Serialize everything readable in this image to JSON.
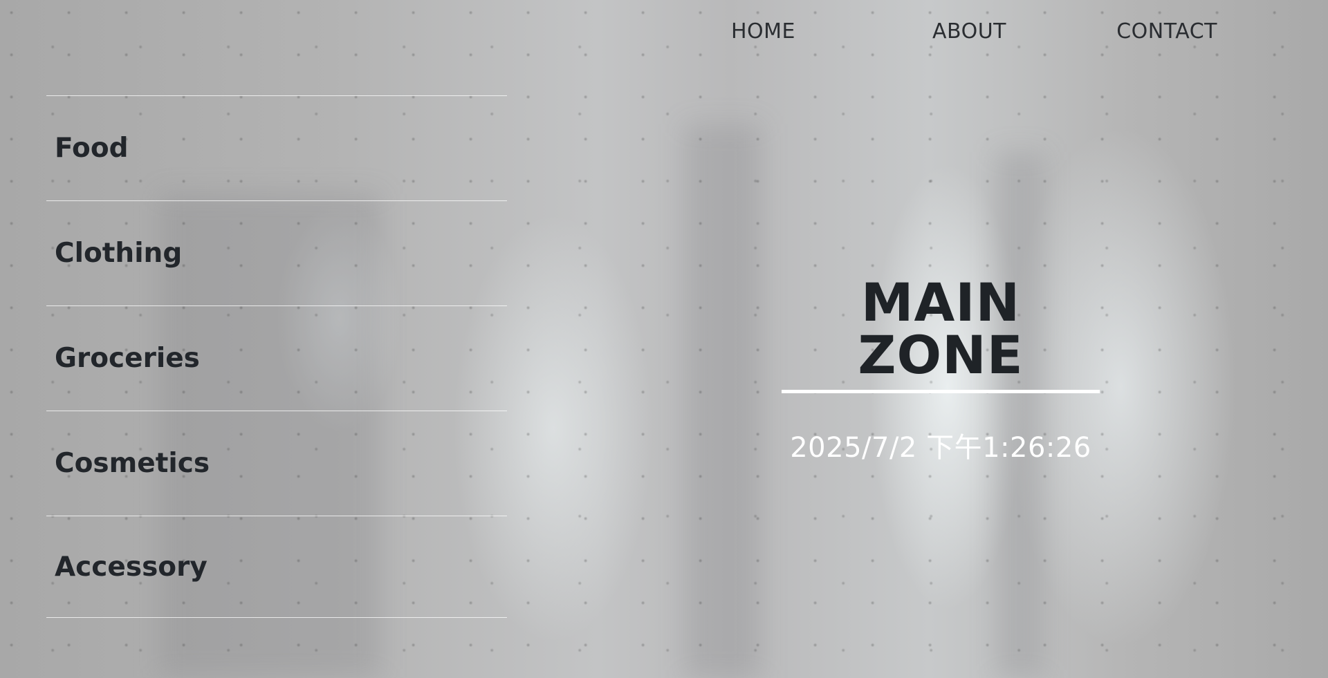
{
  "nav": {
    "home": "HOME",
    "about": "ABOUT",
    "contact": "CONTACT"
  },
  "categories": [
    "Food",
    "Clothing",
    "Groceries",
    "Cosmetics",
    "Accessory"
  ],
  "hero": {
    "title": "MAIN ZONE",
    "datetime": "2025/7/2 下午1:26:26"
  },
  "colors": {
    "text": "#22262b",
    "title": "#1f2327",
    "underline": "#ffffff",
    "datetime": "#ffffff"
  }
}
